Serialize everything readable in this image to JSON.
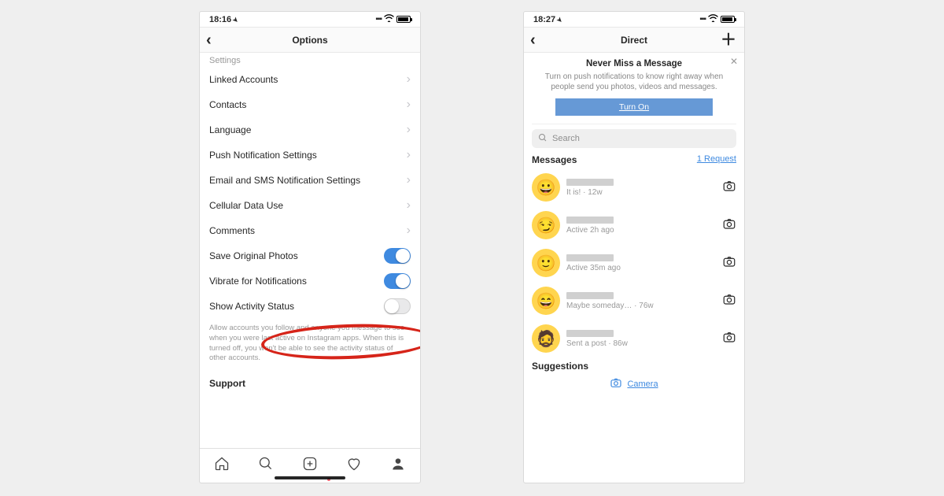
{
  "left": {
    "status_time": "18:16",
    "header_title": "Options",
    "cutoff": "Settings",
    "rows_nav": [
      {
        "label": "Linked Accounts"
      },
      {
        "label": "Contacts"
      },
      {
        "label": "Language"
      },
      {
        "label": "Push Notification Settings"
      },
      {
        "label": "Email and SMS Notification Settings"
      },
      {
        "label": "Cellular Data Use"
      },
      {
        "label": "Comments"
      }
    ],
    "rows_toggle": [
      {
        "label": "Save Original Photos",
        "on": true
      },
      {
        "label": "Vibrate for Notifications",
        "on": true
      },
      {
        "label": "Show Activity Status",
        "on": false
      }
    ],
    "description": "Allow accounts you follow and anyone you message to see when you were last active on Instagram apps. When this is turned off, you won't be able to see the activity status of other accounts.",
    "support": "Support"
  },
  "right": {
    "status_time": "18:27",
    "header_title": "Direct",
    "banner": {
      "title": "Never Miss a Message",
      "body": "Turn on push notifications to know right away when people send you photos, videos and messages.",
      "button": "Turn On"
    },
    "search_placeholder": "Search",
    "messages_header": "Messages",
    "request_link": "1 Request",
    "messages": [
      {
        "face": "😀",
        "sub": "It is! · 12w"
      },
      {
        "face": "😏",
        "sub": "Active 2h ago"
      },
      {
        "face": "🙂",
        "sub": "Active 35m ago"
      },
      {
        "face": "😄",
        "sub": "Maybe someday… · 76w"
      },
      {
        "face": "🧔",
        "sub": "Sent a post · 86w"
      }
    ],
    "suggestions": "Suggestions",
    "camera_label": "Camera"
  }
}
